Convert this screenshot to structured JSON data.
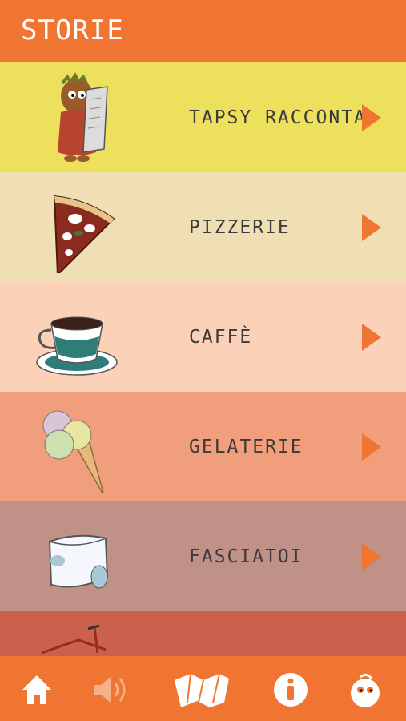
{
  "header": {
    "title": "STORIE"
  },
  "rows": [
    {
      "label": "TAPSY RACCONTA",
      "icon": "caesar-mascot-icon",
      "color": "#ece05c"
    },
    {
      "label": "PIZZERIE",
      "icon": "pizza-slice-icon",
      "color": "#f0deb5"
    },
    {
      "label": "CAFFÈ",
      "icon": "coffee-cup-icon",
      "color": "#fbd2b8"
    },
    {
      "label": "GELATERIE",
      "icon": "ice-cream-cone-icon",
      "color": "#f09e7c"
    },
    {
      "label": "FASCIATOI",
      "icon": "diaper-icon",
      "color": "#c09287"
    },
    {
      "label": "",
      "icon": "bicycle-icon",
      "color": "#c9614d"
    }
  ],
  "footer": {
    "icons": [
      "home-icon",
      "speaker-icon",
      "map-icon",
      "info-icon",
      "mascot-icon"
    ]
  },
  "colors": {
    "accent": "#f07432"
  }
}
